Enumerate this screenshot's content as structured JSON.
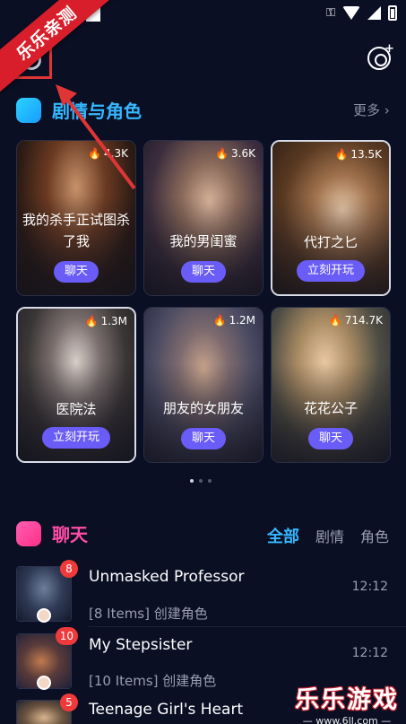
{
  "status_bar": {
    "icons": [
      "key-icon",
      "wifi-icon",
      "signal-icon",
      "battery-icon"
    ]
  },
  "overlay": {
    "ribbon_text": "乐乐亲测"
  },
  "section_roles": {
    "title": "剧情与角色",
    "more": "更多"
  },
  "cards": [
    {
      "count": "4.3K",
      "name": "我的杀手正试图杀了我",
      "button": "聊天"
    },
    {
      "count": "3.6K",
      "name": "我的男闺蜜",
      "button": "聊天"
    },
    {
      "count": "13.5K",
      "name": "代打之匕",
      "button": "立刻开玩"
    },
    {
      "count": "1.3M",
      "name": "医院法",
      "button": "立刻开玩"
    },
    {
      "count": "1.2M",
      "name": "朋友的女朋友",
      "button": "聊天"
    },
    {
      "count": "714.7K",
      "name": "花花公子",
      "button": "聊天"
    }
  ],
  "section_chat": {
    "title": "聊天",
    "tabs": [
      "全部",
      "剧情",
      "角色"
    ]
  },
  "chats": [
    {
      "name": "Unmasked Professor",
      "subtitle": "[8 Items]  创建角色",
      "time": "12:12",
      "badge": "8"
    },
    {
      "name": "My Stepsister",
      "subtitle": "[10 Items]  创建角色",
      "time": "12:12",
      "badge": "10"
    },
    {
      "name": "Teenage Girl's Heart",
      "subtitle": "",
      "time": "",
      "badge": "5"
    }
  ],
  "watermark": {
    "big": "乐乐游戏",
    "small": "— www.6ll.com —"
  },
  "colors": {
    "accent_cyan": "#35b8ff",
    "accent_pink": "#ff4da6",
    "button_purple": "#6a5cf6",
    "badge_red": "#ee3a3a",
    "background": "#0a0f24"
  }
}
